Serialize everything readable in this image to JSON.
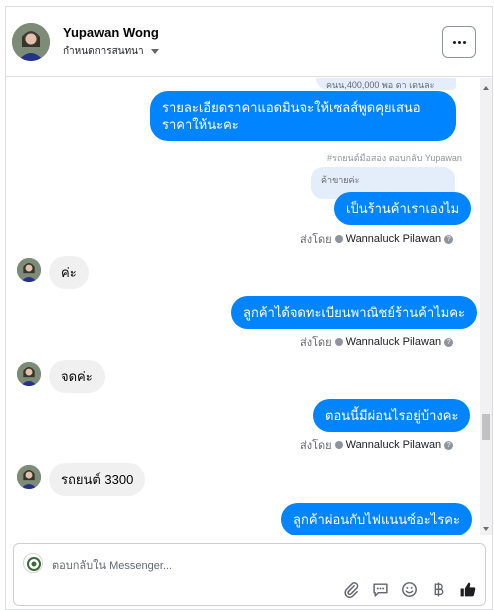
{
  "header": {
    "name": "Yupawan Wong",
    "subtitle": "กำหนดการสนทนา",
    "more_label": "···"
  },
  "thread": {
    "top_quote": "คนน,400,000 พอ ดา เดนละ",
    "messages": [
      {
        "from": "page",
        "text": "รายละเอียดราคาแอดมินจะให้เซลส์พูดคุยเสนอราคาให้นะคะ"
      },
      {
        "reply_note": "#รถยนต์มือสอง ตอบกลับ Yupawan",
        "quote": "ค้าขายค่ะ",
        "from": "page",
        "text": "เป็นร้านค้าเราเองไม"
      },
      {
        "from": "user",
        "text": "ค่ะ"
      },
      {
        "from": "page",
        "text": "ลูกค้าได้จดทะเบียนพาณิชย์ร้านค้าไมคะ"
      },
      {
        "from": "user",
        "text": "จดค่ะ"
      },
      {
        "from": "page",
        "text": "ตอนนี้มีผ่อนไรอยู่บ้างคะ"
      },
      {
        "from": "user",
        "text": "รถยนต์ 3300"
      },
      {
        "from": "page",
        "text": "ลูกค้าผ่อนกับไฟแนนซ์อะไรคะ"
      }
    ],
    "sent_by": {
      "prefix": "ส่งโดย",
      "agent": "Wannaluck Pilawan",
      "help": "?"
    }
  },
  "composer": {
    "placeholder": "ตอบกลับใน Messenger..."
  },
  "tools": [
    "paperclip-icon",
    "saved-reply-icon",
    "emoji-icon",
    "baht-icon",
    "thumbs-up-icon"
  ],
  "colors": {
    "outgoing": "#0084ff",
    "incoming": "#f0f0f0",
    "quote": "#e4eefb",
    "border": "#dadde1"
  }
}
